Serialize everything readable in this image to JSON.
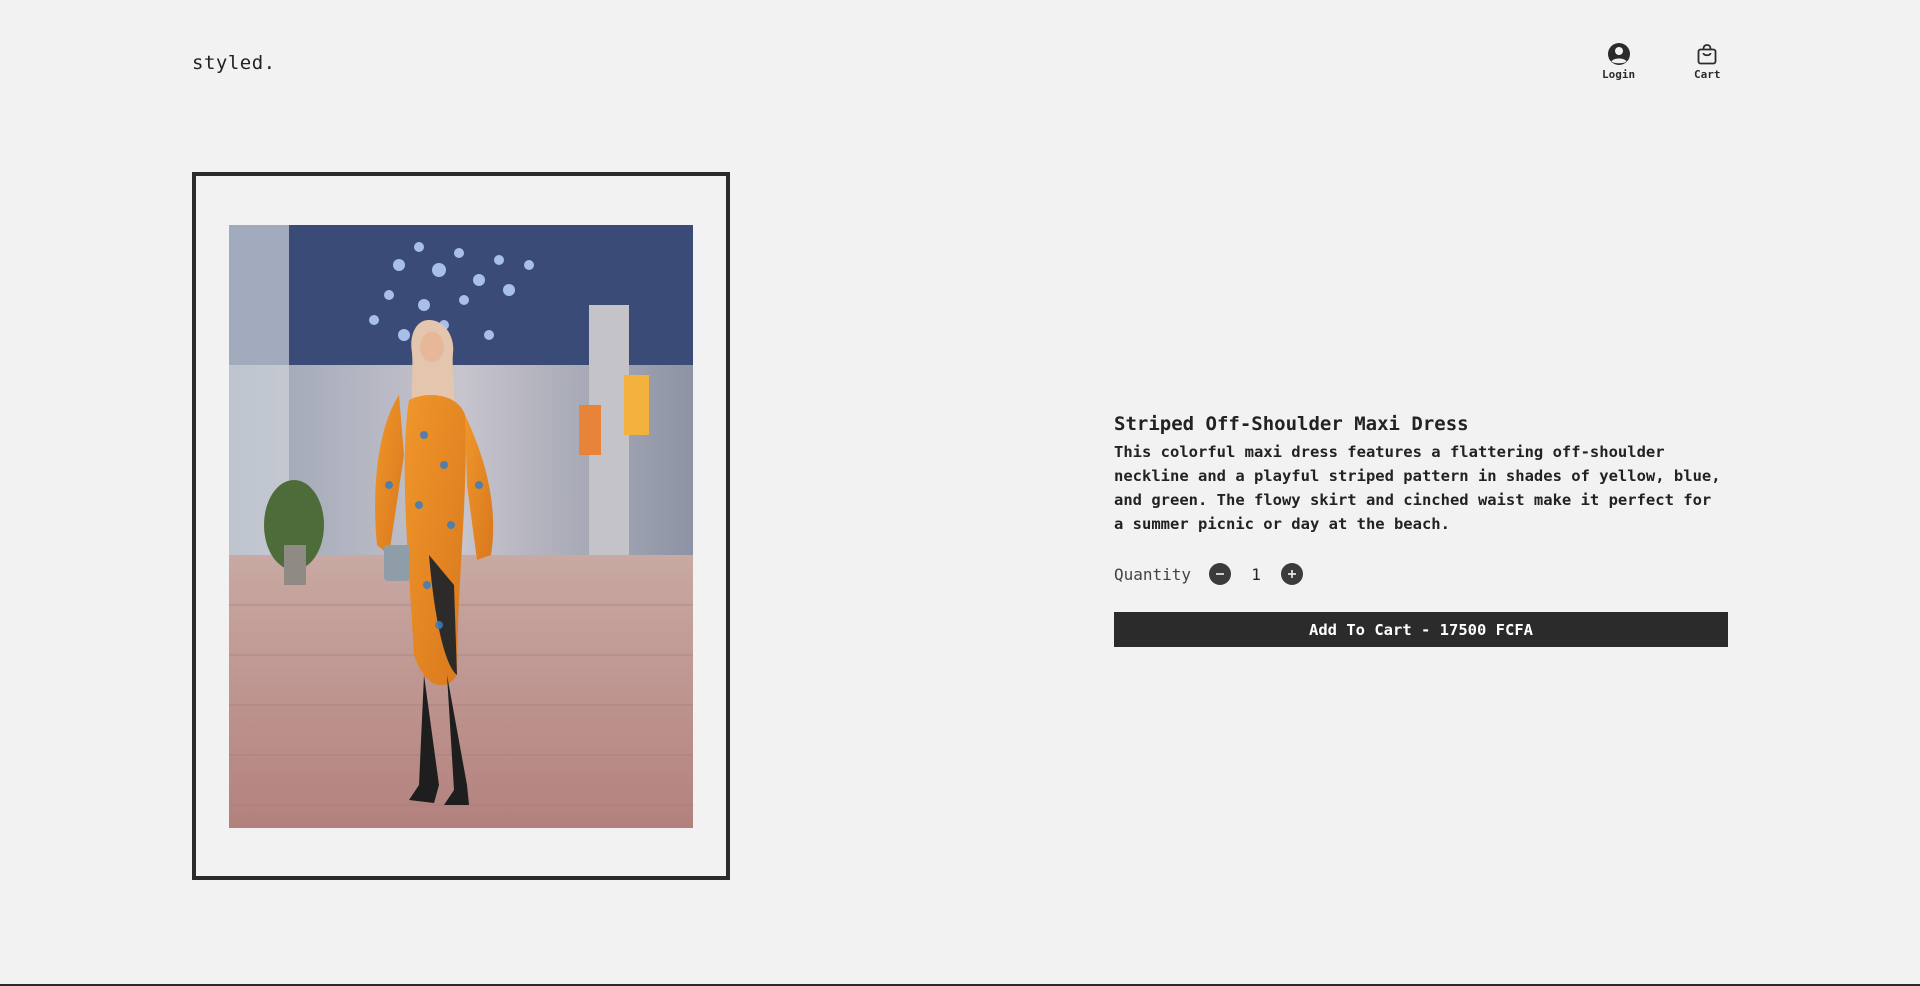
{
  "header": {
    "logo": "styled.",
    "nav": {
      "login_label": "Login",
      "login_icon": "user-circle-icon",
      "cart_label": "Cart",
      "cart_icon": "shopping-bag-icon"
    }
  },
  "product": {
    "image_icon": "product-photo",
    "title": "Striped Off-Shoulder Maxi Dress",
    "description": "This colorful maxi dress features a flattering off-shoulder neckline and a playful striped pattern in shades of yellow, blue, and green. The flowy skirt and cinched waist make it perfect for a summer picnic or day at the beach.",
    "quantity_label": "Quantity",
    "quantity_value": "1",
    "add_to_cart_label": "Add To Cart - 17500 FCFA"
  },
  "colors": {
    "background": "#f2f2f2",
    "accent": "#2b2b2b",
    "button_text": "#ffffff"
  }
}
